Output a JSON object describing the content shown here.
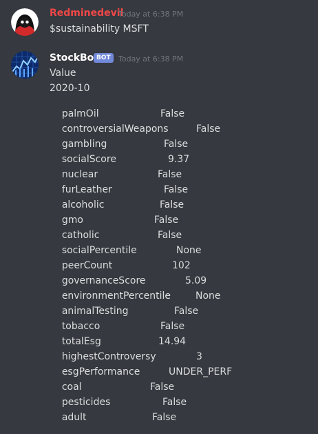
{
  "message1": {
    "username": "Redminedevil",
    "username_color": "#f04747",
    "timestamp": "Today at 6:38 PM",
    "text": "$sustainability MSFT"
  },
  "message2": {
    "username": "StockBot",
    "username_color": "#ffffff",
    "bot_tag": "BOT",
    "timestamp": "Today at 6:38 PM",
    "header": "Value",
    "date": "2020-10",
    "rows": [
      {
        "key": "palmOil",
        "value": "False"
      },
      {
        "key": "controversialWeapons",
        "value": "False"
      },
      {
        "key": "gambling",
        "value": "False"
      },
      {
        "key": "socialScore",
        "value": "9.37"
      },
      {
        "key": "nuclear",
        "value": "False"
      },
      {
        "key": "furLeather",
        "value": "False"
      },
      {
        "key": "alcoholic",
        "value": "False"
      },
      {
        "key": "gmo",
        "value": "False"
      },
      {
        "key": "catholic",
        "value": "False"
      },
      {
        "key": "socialPercentile",
        "value": "None"
      },
      {
        "key": "peerCount",
        "value": "102"
      },
      {
        "key": "governanceScore",
        "value": "5.09"
      },
      {
        "key": "environmentPercentile",
        "value": "None"
      },
      {
        "key": "animalTesting",
        "value": "False"
      },
      {
        "key": "tobacco",
        "value": "False"
      },
      {
        "key": "totalEsg",
        "value": "14.94"
      },
      {
        "key": "highestControversy",
        "value": "3"
      },
      {
        "key": "esgPerformance",
        "value": "UNDER_PERF"
      },
      {
        "key": "coal",
        "value": "False"
      },
      {
        "key": "pesticides",
        "value": "False"
      },
      {
        "key": "adult",
        "value": "False"
      }
    ]
  }
}
